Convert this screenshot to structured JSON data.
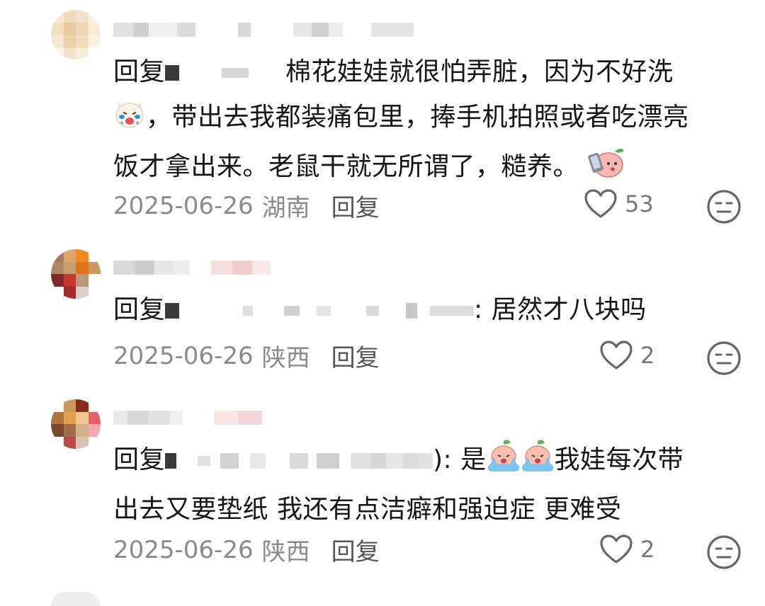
{
  "comments": [
    {
      "reply_label": "回复",
      "text_lines": [
        "棉花娃娃就很怕弄脏，因为不好洗",
        "，带出去我都装痛包里，捧手机拍照或者吃漂亮",
        "饭才拿出来。老鼠干就无所谓了，糙养。"
      ],
      "date": "2025-06-26",
      "location": "湖南",
      "reply_button": "回复",
      "likes": "53"
    },
    {
      "reply_label": "回复",
      "text_lines": [
        ": 居然才八块吗"
      ],
      "date": "2025-06-26",
      "location": "陕西",
      "reply_button": "回复",
      "likes": "2"
    },
    {
      "reply_label": "回复",
      "text_lines": [
        "): 是",
        "我娃每次带",
        "出去又要垫纸 我还有点洁癖和强迫症 更难受"
      ],
      "date": "2025-06-26",
      "location": "陕西",
      "reply_button": "回复",
      "likes": "2"
    }
  ],
  "icons": {
    "like": "heart-outline-icon",
    "dislike": "meh-face-icon",
    "emoji_crying_cat": "crying-cat-emoji",
    "emoji_phone_peach": "peach-selfie-emoji",
    "emoji_crying_peach": "crying-peach-emoji"
  },
  "colors": {
    "text": "#161616",
    "meta": "#8a8a8a",
    "icon": "#666666"
  }
}
